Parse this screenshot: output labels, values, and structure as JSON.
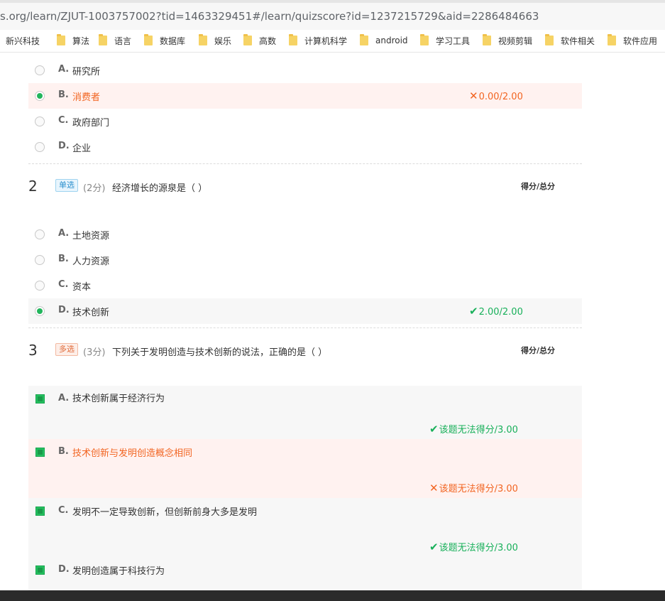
{
  "browser": {
    "url": "s.org/learn/ZJUT-1003757002?tid=1463329451#/learn/quizscore?id=1237215729&aid=2286484663",
    "bookmarks": [
      "新兴科技",
      "算法",
      "语言",
      "数据库",
      "娱乐",
      "高数",
      "计算机科学",
      "android",
      "学习工具",
      "视频剪辑",
      "软件相关",
      "软件应用"
    ]
  },
  "question1": {
    "options": [
      {
        "letter": "A.",
        "text": "研究所"
      },
      {
        "letter": "B.",
        "text": "消费者",
        "score": "0.00/2.00"
      },
      {
        "letter": "C.",
        "text": "政府部门"
      },
      {
        "letter": "D.",
        "text": "企业"
      }
    ]
  },
  "question2": {
    "number": "2",
    "type": "单选",
    "points": "(2分)",
    "text": "经济增长的源泉是（  ）",
    "score_label": "得分/总分",
    "options": [
      {
        "letter": "A.",
        "text": "土地资源"
      },
      {
        "letter": "B.",
        "text": "人力资源"
      },
      {
        "letter": "C.",
        "text": "资本"
      },
      {
        "letter": "D.",
        "text": "技术创新",
        "score": "2.00/2.00"
      }
    ]
  },
  "question3": {
    "number": "3",
    "type": "多选",
    "points": "(3分)",
    "text": "下列关于发明创造与技术创新的说法，正确的是（     ）",
    "score_label": "得分/总分",
    "options": [
      {
        "letter": "A.",
        "text": "技术创新属于经济行为",
        "score": "该题无法得分/3.00"
      },
      {
        "letter": "B.",
        "text": "技术创新与发明创造概念相同",
        "score": "该题无法得分/3.00"
      },
      {
        "letter": "C.",
        "text": "发明不一定导致创新，但创新前身大多是发明",
        "score": "该题无法得分/3.00"
      },
      {
        "letter": "D.",
        "text": "发明创造属于科技行为"
      }
    ]
  },
  "colors": {
    "correct": "#18b05a",
    "wrong": "#f26522",
    "wrong_bg": "#fff2f0",
    "grey_bg": "#f7f7f7"
  }
}
